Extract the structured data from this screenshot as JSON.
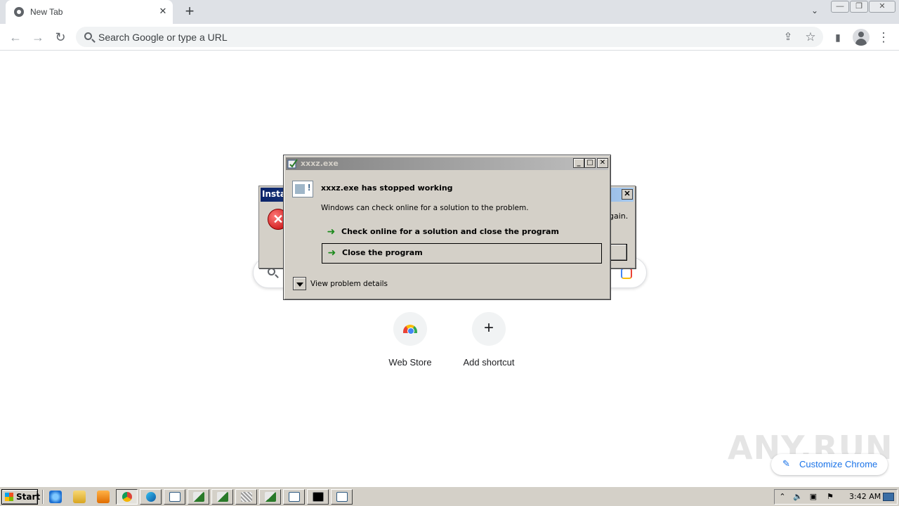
{
  "browser": {
    "tab": {
      "title": "New Tab",
      "close_glyph": "✕",
      "favicon": "chrome-icon"
    },
    "new_tab_glyph": "+",
    "tab_search_glyph": "⌄",
    "window_controls": {
      "minimize": "—",
      "restore": "❐",
      "close": "✕"
    },
    "toolbar": {
      "back_glyph": "←",
      "forward_glyph": "→",
      "reload_glyph": "↻",
      "omnibox_placeholder": "Search Google or type a URL",
      "share_glyph": "⇪",
      "bookmark_glyph": "☆",
      "side_panel_glyph": "▮",
      "menu_glyph": "⋮"
    }
  },
  "ntp": {
    "shortcuts": [
      {
        "label": "Web Store",
        "icon": "web-store-icon"
      },
      {
        "label": "Add shortcut",
        "icon": "plus-icon",
        "glyph": "+"
      }
    ],
    "customize_label": "Customize Chrome",
    "pencil_glyph": "✎",
    "watermark": "ANY.RUN"
  },
  "background_dialog": {
    "title": "Insta",
    "close_glyph": "✕",
    "error_glyph": "✕",
    "text": "gain."
  },
  "crash_dialog": {
    "title": "xxxz.exe",
    "caption_buttons": {
      "minimize": "_",
      "maximize": "□",
      "close": "✕"
    },
    "heading": "xxxz.exe has stopped working",
    "description": "Windows can check online for a solution to the problem.",
    "options": [
      {
        "label": "Check online for a solution and close the program",
        "selected": false
      },
      {
        "label": "Close the program",
        "selected": true
      }
    ],
    "arrow_glyph": "➜",
    "details_label": "View problem details"
  },
  "taskbar": {
    "start_label": "Start",
    "clock": "3:42 AM",
    "tray_glyphs": [
      "⌃",
      "🔈",
      "▣",
      "⚑"
    ],
    "colors": {
      "accent": "#3a6ea5",
      "face": "#d4d0c8"
    }
  }
}
